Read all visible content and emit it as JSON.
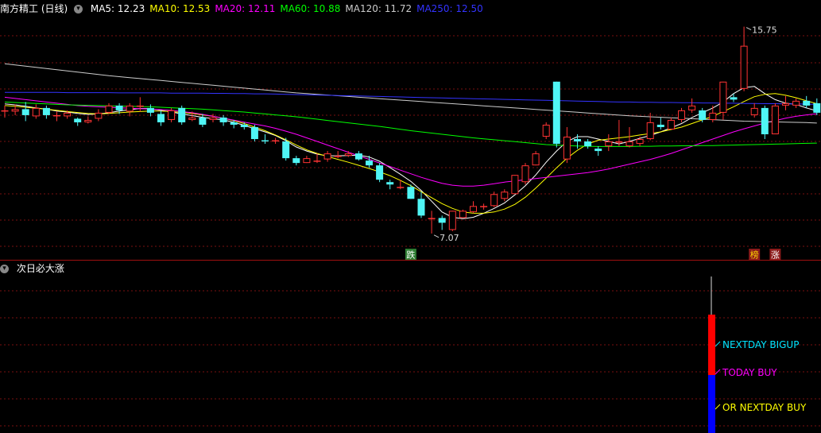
{
  "header": {
    "stock_title": "南方精工 (日线)",
    "ma_labels": [
      {
        "text": "MA5: 12.23",
        "color": "#ffffff"
      },
      {
        "text": "MA10: 12.53",
        "color": "#ffff00"
      },
      {
        "text": "MA20: 12.11",
        "color": "#ff00ff"
      },
      {
        "text": "MA60: 10.88",
        "color": "#00ff00"
      },
      {
        "text": "MA120: 11.72",
        "color": "#cccccc"
      },
      {
        "text": "MA250: 12.50",
        "color": "#3333ff"
      }
    ]
  },
  "indicator_panel": {
    "title": "次日必大涨",
    "signals": [
      {
        "text": "NEXTDAY BIGUP",
        "color": "#00e5ff"
      },
      {
        "text": "TODAY BUY",
        "color": "#ff00ff"
      },
      {
        "text": "OR NEXTDAY BUY",
        "color": "#ffff00"
      }
    ]
  },
  "badges": [
    {
      "text": "跌",
      "bg": "#2e7d32",
      "fg": "#ffffff"
    },
    {
      "text": "榜",
      "bg": "#8b1a1a",
      "fg": "#ffd700"
    },
    {
      "text": "涨",
      "bg": "#8b1a1a",
      "fg": "#ffffff"
    }
  ],
  "colors": {
    "up": "#ff3333",
    "down": "#4ff5f5",
    "grid": "#7a1010",
    "divider": "#a01010",
    "vol_red": "#ff0000",
    "vol_blue": "#0000ff"
  },
  "chart_data": {
    "type": "candlestick",
    "ylim": [
      6.5,
      16.2
    ],
    "high_annotation": {
      "text": "15.75",
      "value": 15.75
    },
    "low_annotation": {
      "text": "7.07",
      "value": 7.07
    },
    "candles": [
      [
        12.2,
        12.25,
        12.45,
        11.95
      ],
      [
        12.2,
        12.3,
        12.5,
        12.05
      ],
      [
        12.3,
        12.05,
        12.6,
        11.8
      ],
      [
        12.0,
        12.35,
        12.5,
        11.9
      ],
      [
        12.35,
        12.05,
        12.45,
        11.9
      ],
      [
        12.0,
        12.05,
        12.2,
        11.8
      ],
      [
        12.0,
        12.15,
        12.25,
        11.9
      ],
      [
        11.9,
        11.75,
        11.95,
        11.6
      ],
      [
        11.75,
        11.85,
        12.0,
        11.7
      ],
      [
        11.9,
        12.15,
        12.3,
        11.8
      ],
      [
        12.15,
        12.45,
        12.55,
        12.1
      ],
      [
        12.45,
        12.25,
        12.55,
        12.1
      ],
      [
        12.2,
        12.45,
        12.55,
        12.0
      ],
      [
        12.45,
        12.45,
        12.8,
        12.2
      ],
      [
        12.35,
        12.15,
        12.5,
        12.0
      ],
      [
        12.1,
        11.75,
        12.25,
        11.6
      ],
      [
        11.85,
        12.25,
        12.35,
        11.75
      ],
      [
        12.35,
        11.75,
        12.45,
        11.65
      ],
      [
        11.85,
        11.95,
        12.2,
        11.8
      ],
      [
        11.95,
        11.65,
        12.1,
        11.55
      ],
      [
        11.85,
        11.95,
        12.1,
        11.75
      ],
      [
        11.95,
        11.75,
        12.05,
        11.6
      ],
      [
        11.75,
        11.65,
        11.85,
        11.5
      ],
      [
        11.65,
        11.55,
        11.75,
        11.45
      ],
      [
        11.55,
        11.05,
        11.65,
        10.95
      ],
      [
        11.0,
        10.95,
        11.25,
        10.85
      ],
      [
        10.95,
        11.0,
        11.1,
        10.85
      ],
      [
        10.95,
        10.25,
        11.1,
        10.15
      ],
      [
        10.25,
        10.05,
        10.35,
        9.95
      ],
      [
        10.05,
        10.25,
        10.35,
        10.05
      ],
      [
        10.15,
        10.15,
        10.45,
        10.05
      ],
      [
        10.2,
        10.45,
        10.55,
        10.1
      ],
      [
        10.35,
        10.35,
        10.55,
        10.25
      ],
      [
        10.35,
        10.45,
        10.55,
        10.3
      ],
      [
        10.45,
        10.2,
        10.55,
        10.15
      ],
      [
        10.15,
        9.95,
        10.35,
        9.85
      ],
      [
        9.95,
        9.35,
        10.05,
        9.25
      ],
      [
        9.25,
        9.15,
        9.35,
        8.95
      ],
      [
        9.05,
        9.05,
        9.35,
        8.95
      ],
      [
        9.05,
        8.55,
        9.15,
        8.55
      ],
      [
        8.55,
        7.85,
        8.85,
        7.75
      ],
      [
        7.7,
        7.75,
        8.05,
        7.1
      ],
      [
        7.75,
        7.55,
        7.85,
        7.25
      ],
      [
        7.25,
        8.05,
        8.05,
        7.2
      ],
      [
        7.75,
        8.05,
        8.1,
        7.8
      ],
      [
        8.0,
        8.25,
        8.45,
        7.95
      ],
      [
        8.25,
        8.25,
        8.35,
        8.1
      ],
      [
        8.25,
        8.75,
        8.85,
        8.2
      ],
      [
        8.55,
        8.85,
        8.95,
        8.45
      ],
      [
        8.75,
        9.55,
        9.55,
        8.85
      ],
      [
        9.25,
        9.95,
        10.05,
        9.15
      ],
      [
        9.95,
        10.45,
        10.55,
        9.95
      ],
      [
        11.15,
        11.65,
        11.75,
        11.05
      ],
      [
        13.45,
        10.85,
        13.45,
        10.7
      ],
      [
        10.2,
        11.15,
        11.55,
        10.05
      ],
      [
        11.05,
        10.95,
        11.25,
        10.65
      ],
      [
        10.95,
        10.75,
        11.05,
        10.65
      ],
      [
        10.65,
        10.55,
        10.75,
        10.35
      ],
      [
        10.75,
        10.95,
        11.25,
        10.55
      ],
      [
        10.95,
        10.95,
        11.85,
        10.75
      ],
      [
        10.75,
        10.95,
        11.55,
        10.7
      ],
      [
        10.85,
        11.05,
        11.15,
        10.75
      ],
      [
        11.05,
        11.75,
        12.15,
        11.0
      ],
      [
        11.65,
        11.55,
        11.95,
        11.45
      ],
      [
        11.45,
        11.85,
        11.95,
        11.45
      ],
      [
        11.85,
        12.25,
        12.35,
        11.75
      ],
      [
        12.25,
        12.45,
        12.75,
        12.15
      ],
      [
        12.25,
        11.85,
        12.35,
        11.75
      ],
      [
        11.85,
        12.15,
        12.45,
        11.75
      ],
      [
        12.15,
        13.45,
        13.45,
        11.85
      ],
      [
        12.8,
        12.7,
        12.95,
        12.6
      ],
      [
        13.15,
        14.95,
        15.75,
        13.05
      ],
      [
        12.05,
        12.35,
        12.55,
        11.95
      ],
      [
        12.35,
        11.25,
        12.45,
        11.05
      ],
      [
        11.25,
        12.45,
        12.55,
        11.25
      ],
      [
        12.45,
        12.55,
        12.85,
        12.25
      ],
      [
        12.45,
        12.65,
        12.75,
        12.35
      ],
      [
        12.65,
        12.45,
        12.85,
        12.35
      ],
      [
        12.55,
        12.15,
        12.75,
        12.05
      ]
    ],
    "ma_series": [
      {
        "name": "MA5",
        "color": "#ffffff",
        "values": [
          12.52,
          12.48,
          12.42,
          12.35,
          12.3,
          12.22,
          12.18,
          12.12,
          12.08,
          12.1,
          12.15,
          12.22,
          12.28,
          12.33,
          12.32,
          12.25,
          12.18,
          12.1,
          12.03,
          11.96,
          11.9,
          11.85,
          11.75,
          11.63,
          11.48,
          11.35,
          11.2,
          10.98,
          10.72,
          10.55,
          10.42,
          10.35,
          10.35,
          10.36,
          10.38,
          10.3,
          10.12,
          9.86,
          9.58,
          9.28,
          8.9,
          8.45,
          8.0,
          7.78,
          7.72,
          7.78,
          7.95,
          8.15,
          8.38,
          8.72,
          9.1,
          9.55,
          10.08,
          10.55,
          10.95,
          11.15,
          11.15,
          11.05,
          10.95,
          10.85,
          10.95,
          11.08,
          11.2,
          11.35,
          11.52,
          11.7,
          11.95,
          12.15,
          12.35,
          12.6,
          12.95,
          13.2,
          13.25,
          12.95,
          12.7,
          12.55,
          12.5,
          12.35,
          12.23
        ]
      },
      {
        "name": "MA10",
        "color": "#ffff00",
        "values": [
          12.45,
          12.42,
          12.38,
          12.34,
          12.3,
          12.25,
          12.2,
          12.16,
          12.12,
          12.1,
          12.12,
          12.15,
          12.18,
          12.2,
          12.22,
          12.22,
          12.2,
          12.16,
          12.12,
          12.06,
          12.0,
          11.92,
          11.82,
          11.7,
          11.55,
          11.4,
          11.22,
          11.02,
          10.8,
          10.6,
          10.45,
          10.32,
          10.2,
          10.08,
          9.95,
          9.82,
          9.68,
          9.52,
          9.32,
          9.1,
          8.85,
          8.6,
          8.35,
          8.15,
          8.0,
          7.95,
          7.95,
          8.0,
          8.12,
          8.32,
          8.62,
          9.0,
          9.42,
          9.85,
          10.25,
          10.58,
          10.85,
          11.0,
          11.05,
          11.1,
          11.15,
          11.22,
          11.28,
          11.35,
          11.45,
          11.55,
          11.7,
          11.85,
          12.0,
          12.2,
          12.4,
          12.62,
          12.82,
          12.92,
          12.95,
          12.88,
          12.78,
          12.65,
          12.53
        ]
      },
      {
        "name": "MA20",
        "color": "#ff00ff",
        "values": [
          12.8,
          12.75,
          12.7,
          12.65,
          12.6,
          12.55,
          12.5,
          12.45,
          12.42,
          12.4,
          12.38,
          12.36,
          12.34,
          12.32,
          12.3,
          12.28,
          12.25,
          12.2,
          12.15,
          12.08,
          12.0,
          11.92,
          11.84,
          11.76,
          11.68,
          11.6,
          11.5,
          11.38,
          11.25,
          11.1,
          10.95,
          10.8,
          10.65,
          10.5,
          10.35,
          10.2,
          10.05,
          9.9,
          9.75,
          9.6,
          9.45,
          9.32,
          9.2,
          9.12,
          9.08,
          9.08,
          9.12,
          9.18,
          9.25,
          9.3,
          9.35,
          9.4,
          9.45,
          9.5,
          9.55,
          9.6,
          9.65,
          9.72,
          9.8,
          9.9,
          10.0,
          10.1,
          10.2,
          10.32,
          10.45,
          10.6,
          10.75,
          10.9,
          11.05,
          11.2,
          11.35,
          11.48,
          11.6,
          11.72,
          11.82,
          11.92,
          12.0,
          12.06,
          12.11
        ]
      },
      {
        "name": "MA60",
        "color": "#00ff00",
        "values": [
          12.6,
          12.58,
          12.56,
          12.54,
          12.52,
          12.5,
          12.48,
          12.47,
          12.46,
          12.45,
          12.44,
          12.43,
          12.42,
          12.41,
          12.4,
          12.38,
          12.36,
          12.34,
          12.32,
          12.3,
          12.27,
          12.24,
          12.21,
          12.18,
          12.14,
          12.1,
          12.06,
          12.02,
          11.98,
          11.93,
          11.88,
          11.83,
          11.78,
          11.73,
          11.68,
          11.63,
          11.58,
          11.52,
          11.46,
          11.4,
          11.35,
          11.3,
          11.25,
          11.2,
          11.15,
          11.1,
          11.06,
          11.02,
          10.98,
          10.94,
          10.9,
          10.86,
          10.82,
          10.8,
          10.78,
          10.76,
          10.75,
          10.74,
          10.74,
          10.74,
          10.74,
          10.75,
          10.75,
          10.76,
          10.76,
          10.77,
          10.77,
          10.78,
          10.78,
          10.79,
          10.8,
          10.81,
          10.82,
          10.83,
          10.84,
          10.85,
          10.86,
          10.87,
          10.88
        ]
      },
      {
        "name": "MA120",
        "color": "#cccccc",
        "values": [
          14.2,
          14.15,
          14.1,
          14.05,
          14.0,
          13.95,
          13.9,
          13.85,
          13.8,
          13.75,
          13.7,
          13.66,
          13.62,
          13.58,
          13.54,
          13.5,
          13.46,
          13.42,
          13.38,
          13.34,
          13.3,
          13.26,
          13.22,
          13.18,
          13.14,
          13.1,
          13.06,
          13.02,
          12.98,
          12.95,
          12.92,
          12.89,
          12.86,
          12.83,
          12.8,
          12.77,
          12.74,
          12.71,
          12.68,
          12.65,
          12.62,
          12.59,
          12.56,
          12.53,
          12.5,
          12.47,
          12.44,
          12.41,
          12.38,
          12.35,
          12.32,
          12.29,
          12.26,
          12.23,
          12.2,
          12.17,
          12.14,
          12.11,
          12.08,
          12.05,
          12.02,
          12.0,
          11.98,
          11.96,
          11.94,
          11.92,
          11.9,
          11.88,
          11.86,
          11.84,
          11.82,
          11.8,
          11.79,
          11.78,
          11.77,
          11.76,
          11.75,
          11.74,
          11.72
        ]
      },
      {
        "name": "MA250",
        "color": "#3333ff",
        "values": [
          13.0,
          13.0,
          13.0,
          13.0,
          13.0,
          13.0,
          12.99,
          12.99,
          12.99,
          12.99,
          12.99,
          12.98,
          12.98,
          12.98,
          12.98,
          12.98,
          12.97,
          12.97,
          12.97,
          12.97,
          12.96,
          12.96,
          12.95,
          12.95,
          12.94,
          12.94,
          12.93,
          12.92,
          12.91,
          12.9,
          12.89,
          12.88,
          12.87,
          12.86,
          12.85,
          12.84,
          12.83,
          12.82,
          12.81,
          12.8,
          12.79,
          12.78,
          12.77,
          12.76,
          12.75,
          12.74,
          12.73,
          12.72,
          12.71,
          12.7,
          12.69,
          12.68,
          12.67,
          12.66,
          12.65,
          12.64,
          12.63,
          12.62,
          12.61,
          12.6,
          12.6,
          12.59,
          12.59,
          12.58,
          12.58,
          12.57,
          12.57,
          12.56,
          12.56,
          12.55,
          12.55,
          12.54,
          12.54,
          12.53,
          12.53,
          12.52,
          12.52,
          12.51,
          12.5
        ]
      }
    ],
    "signal_bar": {
      "index": 71,
      "red_fraction": 0.38,
      "blue_fraction": 0.41,
      "wick_fraction": 0.28
    }
  }
}
